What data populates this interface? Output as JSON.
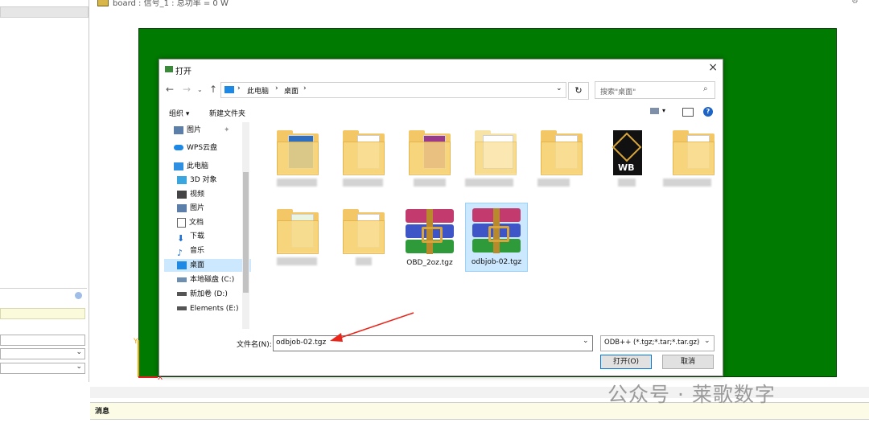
{
  "app": {
    "board_title": "board : 信号_1 : 总功率 = 0 W",
    "message_label": "消息",
    "watermark": "公众号 · 莱歌数字"
  },
  "dialog": {
    "title": "打开",
    "close": "×",
    "breadcrumb": [
      "此电脑",
      "桌面"
    ],
    "search_placeholder": "搜索\"桌面\"",
    "toolbar": {
      "organize": "组织 ▾",
      "new_folder": "新建文件夹"
    },
    "nav_items": [
      {
        "label": "图片",
        "icon": "pictures-icon"
      },
      {
        "label": "WPS云盘",
        "icon": "cloud-icon"
      },
      {
        "label": "此电脑",
        "icon": "computer-icon"
      },
      {
        "label": "3D 对象",
        "icon": "3d-objects-icon"
      },
      {
        "label": "视频",
        "icon": "video-icon"
      },
      {
        "label": "图片",
        "icon": "pictures-icon"
      },
      {
        "label": "文档",
        "icon": "document-icon"
      },
      {
        "label": "下载",
        "icon": "download-icon"
      },
      {
        "label": "音乐",
        "icon": "music-icon"
      },
      {
        "label": "桌面",
        "icon": "desktop-icon",
        "selected": true
      },
      {
        "label": "本地磁盘 (C:)",
        "icon": "drive-icon"
      },
      {
        "label": "新加卷 (D:)",
        "icon": "drive-icon"
      },
      {
        "label": "Elements (E:)",
        "icon": "drive-icon"
      }
    ],
    "files": [
      {
        "name": "OBD_2oz.tgz",
        "type": "archive"
      },
      {
        "name": "odbjob-02.tgz",
        "type": "archive",
        "selected": true
      }
    ],
    "filename_label": "文件名(N):",
    "filename_value": "odbjob-02.tgz",
    "filetype_value": "ODB++ (*.tgz;*.tar;*.tar.gz)",
    "open_button": "打开(O)",
    "cancel_button": "取消"
  },
  "colors": {
    "canvas": "#007a00",
    "selection": "#cce8ff",
    "arrow": "#e8261b"
  }
}
